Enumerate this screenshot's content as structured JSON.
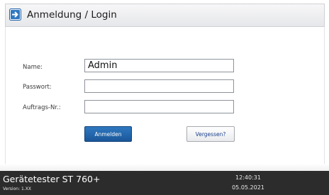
{
  "window": {
    "title": "Anmeldung / Login",
    "icon": "login-arrow-icon"
  },
  "form": {
    "name_label": "Name:",
    "name_value": "Admin",
    "password_label": "Passwort:",
    "password_value": "",
    "order_label": "Auftrags-Nr.:",
    "order_value": ""
  },
  "buttons": {
    "login_label": "Anmelden",
    "forgot_label": "Vergessen?"
  },
  "footer": {
    "device_name": "Gerätetester ST 760+",
    "version": "Version: 1.XX",
    "time": "12:40:31",
    "date": "05.05.2021"
  },
  "colors": {
    "accent": "#1f5fa8",
    "footer_bg": "#2c2c2c",
    "link": "#1b3f8f"
  }
}
